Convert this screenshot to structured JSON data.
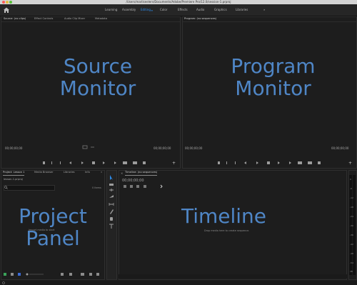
{
  "app": {
    "window_title": "/Users/marliseelers/Documents/Adobe/Premiere Pro/12.0/session-1.prproj",
    "colors": {
      "accent": "#2d8ceb",
      "overlay_text": "#4f86c6",
      "panel_bg": "#1d1d1d"
    }
  },
  "workspaces": [
    "Learning",
    "Assembly",
    "Editing",
    "Color",
    "Effects",
    "Audio",
    "Graphics",
    "Libraries"
  ],
  "workspace_active": "Editing",
  "workspace_overflow": "»",
  "source": {
    "tabs": [
      "Source: (no clips)",
      "Effect Controls",
      "Audio Clip Mixer",
      "Metadata"
    ],
    "timecode_left": "00;00;00;00",
    "timecode_right": "00;00;00;00",
    "overlay": [
      "Source",
      "Monitor"
    ]
  },
  "program": {
    "tab": "Program: (no sequences)",
    "timecode_left": "00;00;00;00",
    "timecode_right": "00;00;00;00",
    "overlay": [
      "Program",
      "Monitor"
    ]
  },
  "project": {
    "tabs": [
      "Project: Lesson 1",
      "Media Browser",
      "Libraries",
      "Info"
    ],
    "overflow": "»",
    "file": "lesson-1.prproj",
    "items_count": "0 Items",
    "empty_text": "Import media to start",
    "overlay": [
      "Project",
      "Panel"
    ]
  },
  "timeline": {
    "tab": "Timeline: (no sequences)",
    "timecode": "00;00;00;00",
    "empty_text": "Drop media here to create sequence.",
    "overlay": "Timeline"
  },
  "meter": {
    "labels": [
      "0",
      "-6",
      "-12",
      "-18",
      "-24",
      "-30",
      "-36",
      "-42",
      "-48",
      "-54",
      "dB"
    ]
  }
}
